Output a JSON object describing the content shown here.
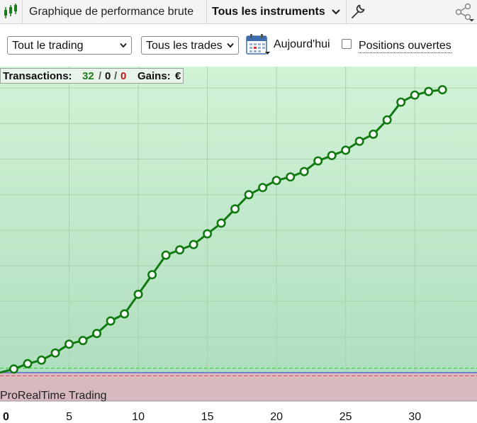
{
  "header": {
    "title": "Graphique de performance brute",
    "instruments_label": "Tous les instruments"
  },
  "filters": {
    "scope_select": "Tout le trading",
    "trades_select": "Tous les trades",
    "today_label": "Aujourd'hui",
    "open_positions_label": "Positions ouvertes",
    "open_positions_checked": false
  },
  "stats": {
    "transactions_label": "Transactions:",
    "total": "32",
    "sep1": "/",
    "middle": "0",
    "sep2": "/",
    "losing": "0",
    "gains_label": "Gains:",
    "gains_currency": "€",
    "total_color": "#1e7b1e",
    "losing_color": "#c0151c"
  },
  "watermark": "ProRealTime Trading",
  "colors": {
    "profit_zone": "#c9efcf",
    "loss_zone": "#d8b9bf",
    "line": "#117a11",
    "zero_line": "#5a6ad0",
    "upper_dashed": "#2ec62e",
    "lower_dashed": "#e0404a"
  },
  "chart_data": {
    "type": "line",
    "title": "",
    "xlabel": "",
    "ylabel": "",
    "x": [
      1,
      2,
      3,
      4,
      5,
      6,
      7,
      8,
      9,
      10,
      11,
      12,
      13,
      14,
      15,
      16,
      17,
      18,
      19,
      20,
      21,
      22,
      23,
      24,
      25,
      26,
      27,
      28,
      29,
      30,
      31,
      32
    ],
    "series": [
      {
        "values": [
          1.0,
          2.5,
          3.5,
          5.5,
          8.0,
          9.0,
          11.0,
          14.5,
          16.5,
          22.0,
          27.5,
          33.0,
          34.5,
          36.0,
          39.0,
          42.0,
          46.0,
          50.0,
          52.0,
          54.0,
          55.0,
          56.5,
          59.5,
          61.0,
          62.5,
          65.0,
          67.0,
          71.0,
          76.0,
          78.0,
          79.0,
          79.5
        ]
      }
    ],
    "x_ticks": [
      "0",
      "5",
      "10",
      "15",
      "20",
      "25",
      "30"
    ],
    "xlim": [
      0,
      34.5
    ],
    "ylim": [
      -8,
      86
    ],
    "grid": true,
    "marker": "hollow-circle"
  }
}
